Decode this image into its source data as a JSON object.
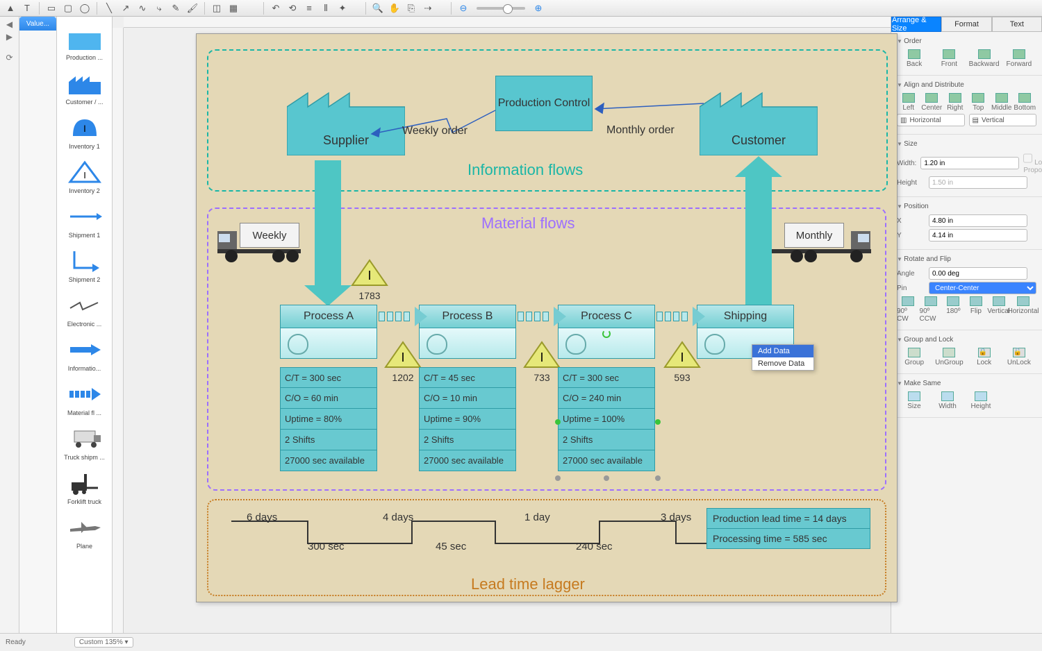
{
  "toolbar": {
    "icons": [
      "arrow",
      "text",
      "rect",
      "rrect",
      "ellipse",
      "line",
      "arrowline",
      "curve",
      "arc",
      "pencil",
      "brush",
      "crop",
      "table",
      "undo",
      "redo",
      "align",
      "distribute",
      "rotate",
      "magnet",
      "hand",
      "hand2",
      "fill",
      "connector",
      "zoom-out",
      "zoom-in"
    ]
  },
  "tabs": {
    "active": "Value..."
  },
  "palette": [
    {
      "name": "production",
      "label": "Production ..."
    },
    {
      "name": "customer",
      "label": "Customer / ..."
    },
    {
      "name": "inventory1",
      "label": "Inventory 1"
    },
    {
      "name": "inventory2",
      "label": "Inventory 2"
    },
    {
      "name": "shipment1",
      "label": "Shipment 1"
    },
    {
      "name": "shipment2",
      "label": "Shipment 2"
    },
    {
      "name": "electronic",
      "label": "Electronic ..."
    },
    {
      "name": "informatio",
      "label": "Informatio..."
    },
    {
      "name": "materialfl",
      "label": "Material fl ..."
    },
    {
      "name": "truckshipm",
      "label": "Truck shipm ..."
    },
    {
      "name": "forklift",
      "label": "Forklift truck"
    },
    {
      "name": "plane",
      "label": "Plane"
    }
  ],
  "diagram": {
    "info_title": "Information flows",
    "mat_title": "Material flows",
    "lead_title": "Lead time lagger",
    "supplier": "Supplier",
    "customer": "Customer",
    "pcontrol": "Production Control",
    "weekly_order": "Weekly order",
    "monthly_order": "Monthly order",
    "truck_weekly": "Weekly",
    "truck_monthly": "Monthly",
    "processes": [
      {
        "name": "Process A",
        "data": [
          "C/T = 300 sec",
          "C/O = 60 min",
          "Uptime = 80%",
          "2 Shifts",
          "27000 sec available"
        ]
      },
      {
        "name": "Process B",
        "data": [
          "C/T = 45 sec",
          "C/O = 10 min",
          "Uptime = 90%",
          "2 Shifts",
          "27000 sec available"
        ]
      },
      {
        "name": "Process C",
        "data": [
          "C/T = 300 sec",
          "C/O = 240 min",
          "Uptime = 100%",
          "2 Shifts",
          "27000 sec available"
        ]
      },
      {
        "name": "Shipping",
        "data": []
      }
    ],
    "inventory": [
      {
        "v": "1783"
      },
      {
        "v": "1202"
      },
      {
        "v": "733"
      },
      {
        "v": "593"
      }
    ],
    "ladder_top": [
      "6 days",
      "4 days",
      "1 day",
      "3 days"
    ],
    "ladder_bot": [
      "300 sec",
      "45 sec",
      "240 sec"
    ],
    "leadsum": [
      "Production lead time = 14 days",
      "Processing time = 585 sec"
    ]
  },
  "context": {
    "add": "Add Data",
    "remove": "Remove Data"
  },
  "rpanel": {
    "tabs": [
      "Arrange & Size",
      "Format",
      "Text"
    ],
    "order": {
      "hdr": "Order",
      "btns": [
        "Back",
        "Front",
        "Backward",
        "Forward"
      ]
    },
    "align": {
      "hdr": "Align and Distribute",
      "btns": [
        "Left",
        "Center",
        "Right",
        "Top",
        "Middle",
        "Bottom"
      ],
      "h": "Horizontal",
      "v": "Vertical"
    },
    "size": {
      "hdr": "Size",
      "width": "Width:",
      "wval": "1.20 in",
      "height": "Height",
      "hval": "1.50 in",
      "lock": "Lock Proportions"
    },
    "position": {
      "hdr": "Position",
      "x": "X",
      "xval": "4.80 in",
      "y": "Y",
      "yval": "4.14 in"
    },
    "rotate": {
      "hdr": "Rotate and Flip",
      "angle": "Angle",
      "aval": "0.00 deg",
      "pin": "Pin",
      "pval": "Center-Center",
      "btns": [
        "90º CW",
        "90º CCW",
        "180º",
        "Flip",
        "Vertical",
        "Horizontal"
      ]
    },
    "group": {
      "hdr": "Group and Lock",
      "btns": [
        "Group",
        "UnGroup",
        "Lock",
        "UnLock"
      ]
    },
    "same": {
      "hdr": "Make Same",
      "btns": [
        "Size",
        "Width",
        "Height"
      ]
    }
  },
  "status": {
    "ready": "Ready",
    "zoom": "Custom 135%"
  }
}
